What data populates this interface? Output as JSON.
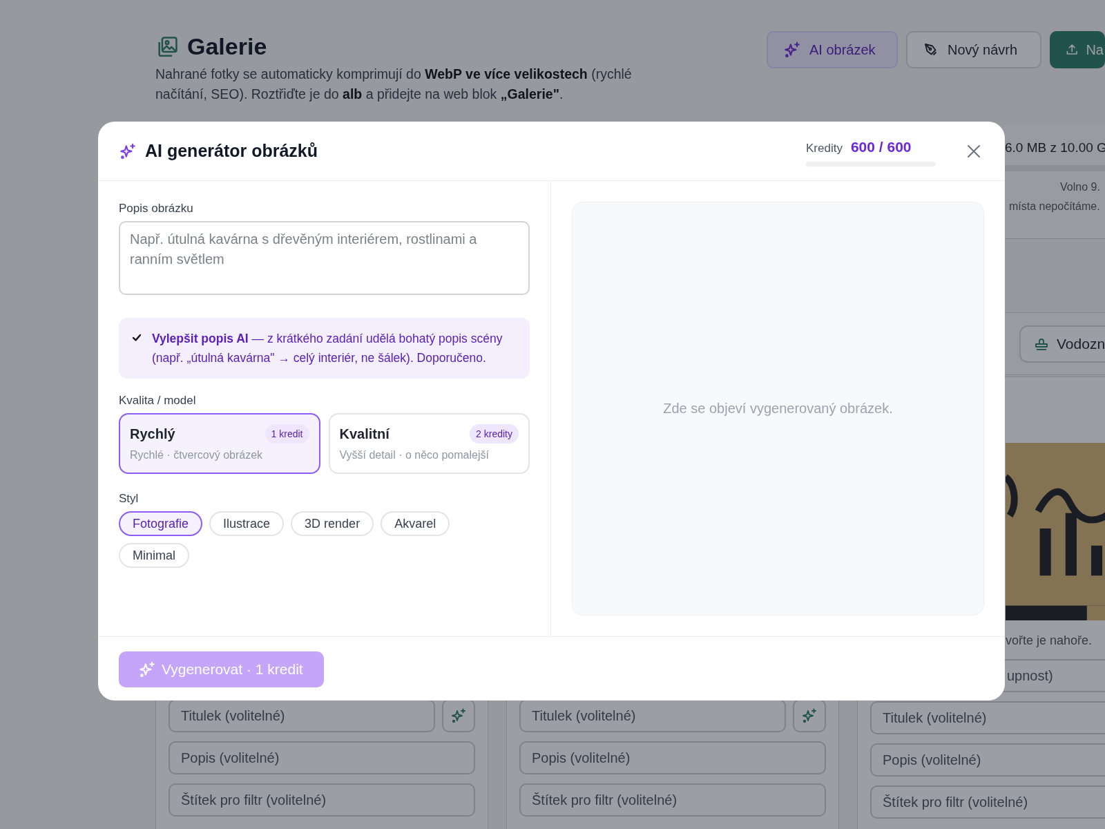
{
  "page": {
    "title": "Galerie",
    "description": "Nahrané fotky se automaticky komprimují do **WebP ve více velikostech** (rychlé načítání, SEO). Roztřiďte je do **alb** a přidejte na web blok **„Galerie\"**.",
    "buttons": [
      {
        "label": "AI obrázek",
        "kind": "ai"
      },
      {
        "label": "Nový návrh",
        "kind": "draft"
      },
      {
        "label": "Na",
        "kind": "upload"
      }
    ]
  },
  "storage": {
    "usage": "6.0 MB z 10.00 G",
    "free": "Volno 9.",
    "note": "místa nepočítáme."
  },
  "toolbar": {
    "buttons": [
      {
        "label": "Vodozn",
        "kind": "watermark"
      }
    ]
  },
  "cards": [
    {
      "title_field": {
        "placeholder": "Titulek (volitelné)",
        "ai_button": true
      },
      "description_field": {
        "placeholder": "Popis (volitelné)"
      },
      "tag_field": {
        "placeholder": "Štítek pro filtr (volitelné)"
      }
    },
    {
      "title_field": {
        "placeholder": "Titulek (volitelné)",
        "ai_button": true
      },
      "description_field": {
        "placeholder": "Popis (volitelné)"
      },
      "tag_field": {
        "placeholder": "Štítek pro filtr (volitelné)"
      }
    },
    {
      "caption": "vořte je nahoře.",
      "alt_field": {
        "placeholder": "upnost)"
      },
      "title_field": {
        "placeholder": "Titulek (volitelné)",
        "ai_button": false
      },
      "description_field": {
        "placeholder": "Popis (volitelné)"
      },
      "tag_field": {
        "placeholder": "Štítek pro filtr (volitelné)"
      }
    }
  ],
  "modal": {
    "title": "AI generátor obrázků",
    "credits_label": "Kredity",
    "credits": "600 / 600",
    "prompt": {
      "label": "Popis obrázku",
      "placeholder": "Např. útulná kavárna s dřevěným interiérem, rostlinami a ranním světlem"
    },
    "enhance": {
      "checked": true,
      "text": "**Vylepšit popis AI** — z krátkého zadání udělá bohatý popis scény (např. „útulná kavárna\" → celý interiér, ne šálek). Doporučeno."
    },
    "quality_label": "Kvalita / model",
    "quality_options": [
      {
        "name": "Rychlý",
        "badge": "1 kredit",
        "description": "Rychlé · čtvercový obrázek",
        "selected": true
      },
      {
        "name": "Kvalitní",
        "badge": "2 kredity",
        "description": "Vyšší detail · o něco pomalejší",
        "selected": false
      }
    ],
    "style_label": "Styl",
    "styles": [
      {
        "label": "Fotografie",
        "selected": true
      },
      {
        "label": "Ilustrace",
        "selected": false
      },
      {
        "label": "3D render",
        "selected": false
      },
      {
        "label": "Akvarel",
        "selected": false
      },
      {
        "label": "Minimal",
        "selected": false
      }
    ],
    "preview_placeholder": "Zde se objeví vygenerovaný obrázek.",
    "generate_button": {
      "label": "Vygenerovat · 1 kredit",
      "disabled": true
    }
  }
}
